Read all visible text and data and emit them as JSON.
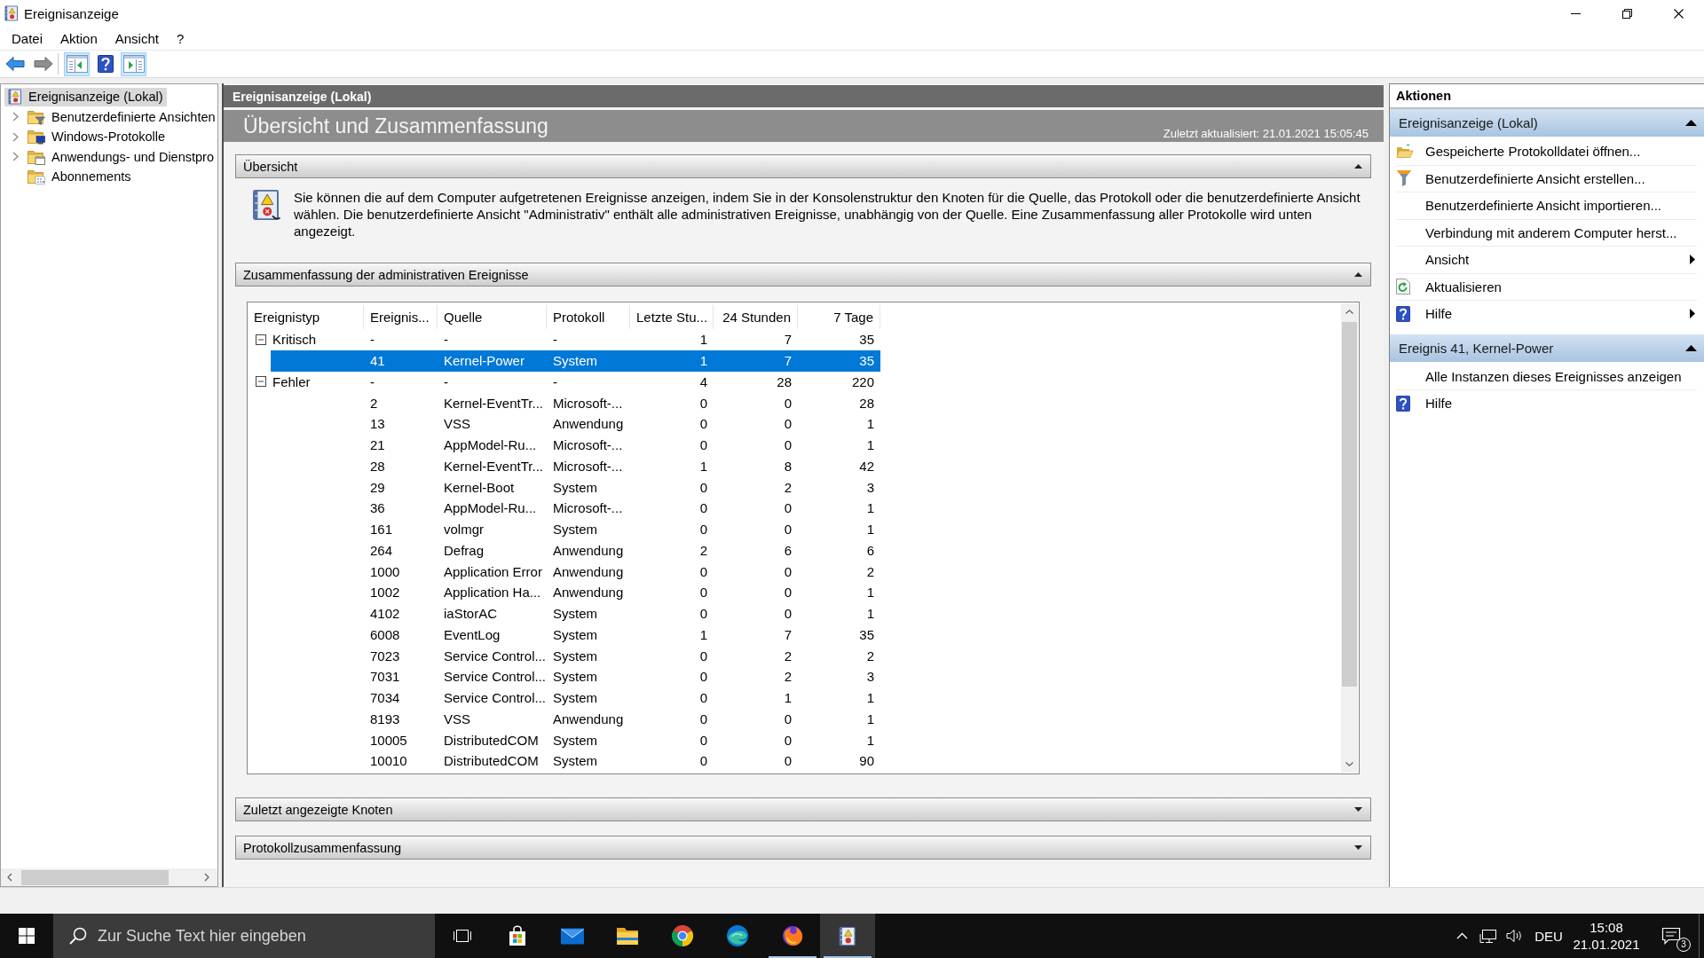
{
  "window": {
    "title": "Ereignisanzeige"
  },
  "menu": [
    "Datei",
    "Aktion",
    "Ansicht",
    "?"
  ],
  "toolbar": [
    [
      {
        "kind": "back",
        "disabled": false,
        "on": false
      },
      {
        "kind": "forward",
        "disabled": true,
        "on": false
      }
    ],
    [
      {
        "kind": "console-tree",
        "disabled": false,
        "on": true
      },
      {
        "kind": "help",
        "disabled": false,
        "on": false
      },
      {
        "kind": "action-pane",
        "disabled": false,
        "on": true
      }
    ]
  ],
  "tree": [
    {
      "label": "Ereignisanzeige (Lokal)",
      "kind": "root",
      "selected": true,
      "expandable": false,
      "children": [
        {
          "label": "Benutzerdefinierte Ansichten",
          "kind": "filter-folder",
          "selected": false,
          "expandable": true
        },
        {
          "label": "Windows-Protokolle",
          "kind": "system-folder",
          "selected": false,
          "expandable": true
        },
        {
          "label": "Anwendungs- und Dienstpro",
          "kind": "window-folder",
          "selected": false,
          "expandable": true
        },
        {
          "label": "Abonnements",
          "kind": "calendar-folder",
          "selected": false,
          "expandable": false
        }
      ]
    }
  ],
  "main": {
    "header": "Ereignisanzeige (Lokal)",
    "title": "Übersicht und Zusammenfassung",
    "updated": "Zuletzt aktualisiert: 21.01.2021 15:05:45",
    "sections": [
      {
        "title": "Übersicht",
        "expanded": true,
        "kind": "description",
        "text": "Sie können die auf dem Computer aufgetretenen Ereignisse anzeigen, indem Sie in der Konsolenstruktur den Knoten für die Quelle, das Protokoll oder die benutzerdefinierte Ansicht wählen. Die benutzerdefinierte Ansicht \"Administrativ\" enthält alle administrativen Ereignisse, unabhängig von der Quelle. Eine Zusammenfassung aller Protokolle wird unten angezeigt."
      },
      {
        "title": "Zusammenfassung der administrativen Ereignisse",
        "expanded": true,
        "kind": "table",
        "table": {
          "columns": [
            "Ereignistyp",
            "Ereignis...",
            "Quelle",
            "Protokoll",
            "Letzte Stu...",
            "24 Stunden",
            "7 Tage"
          ],
          "rows": [
            {
              "cells": [
                "Kritisch",
                "-",
                "-",
                "-",
                "1",
                "7",
                "35"
              ],
              "expanded": true,
              "selected": false,
              "children": [
                {
                  "cells": [
                    "",
                    "41",
                    "Kernel-Power",
                    "System",
                    "1",
                    "7",
                    "35"
                  ],
                  "selected": true
                }
              ]
            },
            {
              "cells": [
                "Fehler",
                "-",
                "-",
                "-",
                "4",
                "28",
                "220"
              ],
              "expanded": true,
              "selected": false,
              "children": [
                {
                  "cells": [
                    "",
                    "2",
                    "Kernel-EventTr...",
                    "Microsoft-...",
                    "0",
                    "0",
                    "28"
                  ],
                  "selected": false
                },
                {
                  "cells": [
                    "",
                    "13",
                    "VSS",
                    "Anwendung",
                    "0",
                    "0",
                    "1"
                  ],
                  "selected": false
                },
                {
                  "cells": [
                    "",
                    "21",
                    "AppModel-Ru...",
                    "Microsoft-...",
                    "0",
                    "0",
                    "1"
                  ],
                  "selected": false
                },
                {
                  "cells": [
                    "",
                    "28",
                    "Kernel-EventTr...",
                    "Microsoft-...",
                    "1",
                    "8",
                    "42"
                  ],
                  "selected": false
                },
                {
                  "cells": [
                    "",
                    "29",
                    "Kernel-Boot",
                    "System",
                    "0",
                    "2",
                    "3"
                  ],
                  "selected": false
                },
                {
                  "cells": [
                    "",
                    "36",
                    "AppModel-Ru...",
                    "Microsoft-...",
                    "0",
                    "0",
                    "1"
                  ],
                  "selected": false
                },
                {
                  "cells": [
                    "",
                    "161",
                    "volmgr",
                    "System",
                    "0",
                    "0",
                    "1"
                  ],
                  "selected": false
                },
                {
                  "cells": [
                    "",
                    "264",
                    "Defrag",
                    "Anwendung",
                    "2",
                    "6",
                    "6"
                  ],
                  "selected": false
                },
                {
                  "cells": [
                    "",
                    "1000",
                    "Application Error",
                    "Anwendung",
                    "0",
                    "0",
                    "2"
                  ],
                  "selected": false
                },
                {
                  "cells": [
                    "",
                    "1002",
                    "Application Ha...",
                    "Anwendung",
                    "0",
                    "0",
                    "1"
                  ],
                  "selected": false
                },
                {
                  "cells": [
                    "",
                    "4102",
                    "iaStorAC",
                    "System",
                    "0",
                    "0",
                    "1"
                  ],
                  "selected": false
                },
                {
                  "cells": [
                    "",
                    "6008",
                    "EventLog",
                    "System",
                    "1",
                    "7",
                    "35"
                  ],
                  "selected": false
                },
                {
                  "cells": [
                    "",
                    "7023",
                    "Service Control...",
                    "System",
                    "0",
                    "2",
                    "2"
                  ],
                  "selected": false
                },
                {
                  "cells": [
                    "",
                    "7031",
                    "Service Control...",
                    "System",
                    "0",
                    "2",
                    "3"
                  ],
                  "selected": false
                },
                {
                  "cells": [
                    "",
                    "7034",
                    "Service Control...",
                    "System",
                    "0",
                    "1",
                    "1"
                  ],
                  "selected": false
                },
                {
                  "cells": [
                    "",
                    "8193",
                    "VSS",
                    "Anwendung",
                    "0",
                    "0",
                    "1"
                  ],
                  "selected": false
                },
                {
                  "cells": [
                    "",
                    "10005",
                    "DistributedCOM",
                    "System",
                    "0",
                    "0",
                    "1"
                  ],
                  "selected": false
                },
                {
                  "cells": [
                    "",
                    "10010",
                    "DistributedCOM",
                    "System",
                    "0",
                    "0",
                    "90"
                  ],
                  "selected": false
                }
              ]
            }
          ]
        }
      },
      {
        "title": "Zuletzt angezeigte Knoten",
        "expanded": false
      },
      {
        "title": "Protokollzusammenfassung",
        "expanded": false
      }
    ]
  },
  "actions": {
    "title": "Aktionen",
    "groups": [
      {
        "title": "Ereignisanzeige (Lokal)",
        "expanded": true,
        "items": [
          {
            "label": "Gespeicherte Protokolldatei öffnen...",
            "kind": "open",
            "submenu": false
          },
          {
            "label": "Benutzerdefinierte Ansicht erstellen...",
            "kind": "filter",
            "submenu": false
          },
          {
            "label": "Benutzerdefinierte Ansicht importieren...",
            "kind": "plain",
            "submenu": false
          },
          {
            "label": "Verbindung mit anderem Computer herst...",
            "kind": "plain",
            "submenu": false
          },
          {
            "label": "Ansicht",
            "kind": "plain",
            "submenu": true
          },
          {
            "label": "Aktualisieren",
            "kind": "refresh",
            "submenu": false
          },
          {
            "label": "Hilfe",
            "kind": "help",
            "submenu": true
          }
        ]
      },
      {
        "title": "Ereignis 41, Kernel-Power",
        "expanded": true,
        "items": [
          {
            "label": "Alle Instanzen dieses Ereignisses anzeigen",
            "kind": "plain",
            "submenu": false
          },
          {
            "label": "Hilfe",
            "kind": "help",
            "submenu": false
          }
        ]
      }
    ]
  },
  "taskbar": {
    "search": {
      "placeholder": "Zur Suche Text hier eingeben"
    },
    "apps": [
      {
        "kind": "shop",
        "running": false,
        "active": false
      },
      {
        "kind": "mail",
        "running": false,
        "active": false
      },
      {
        "kind": "files",
        "running": false,
        "active": false
      },
      {
        "kind": "browser-ring",
        "running": false,
        "active": false
      },
      {
        "kind": "browser-wave",
        "running": false,
        "active": false
      },
      {
        "kind": "browser-flame",
        "running": true,
        "active": false
      },
      {
        "kind": "event-log",
        "running": true,
        "active": true
      }
    ],
    "language": "DEU",
    "time": "15:08",
    "date": "21.01.2021",
    "notifications": "3"
  }
}
